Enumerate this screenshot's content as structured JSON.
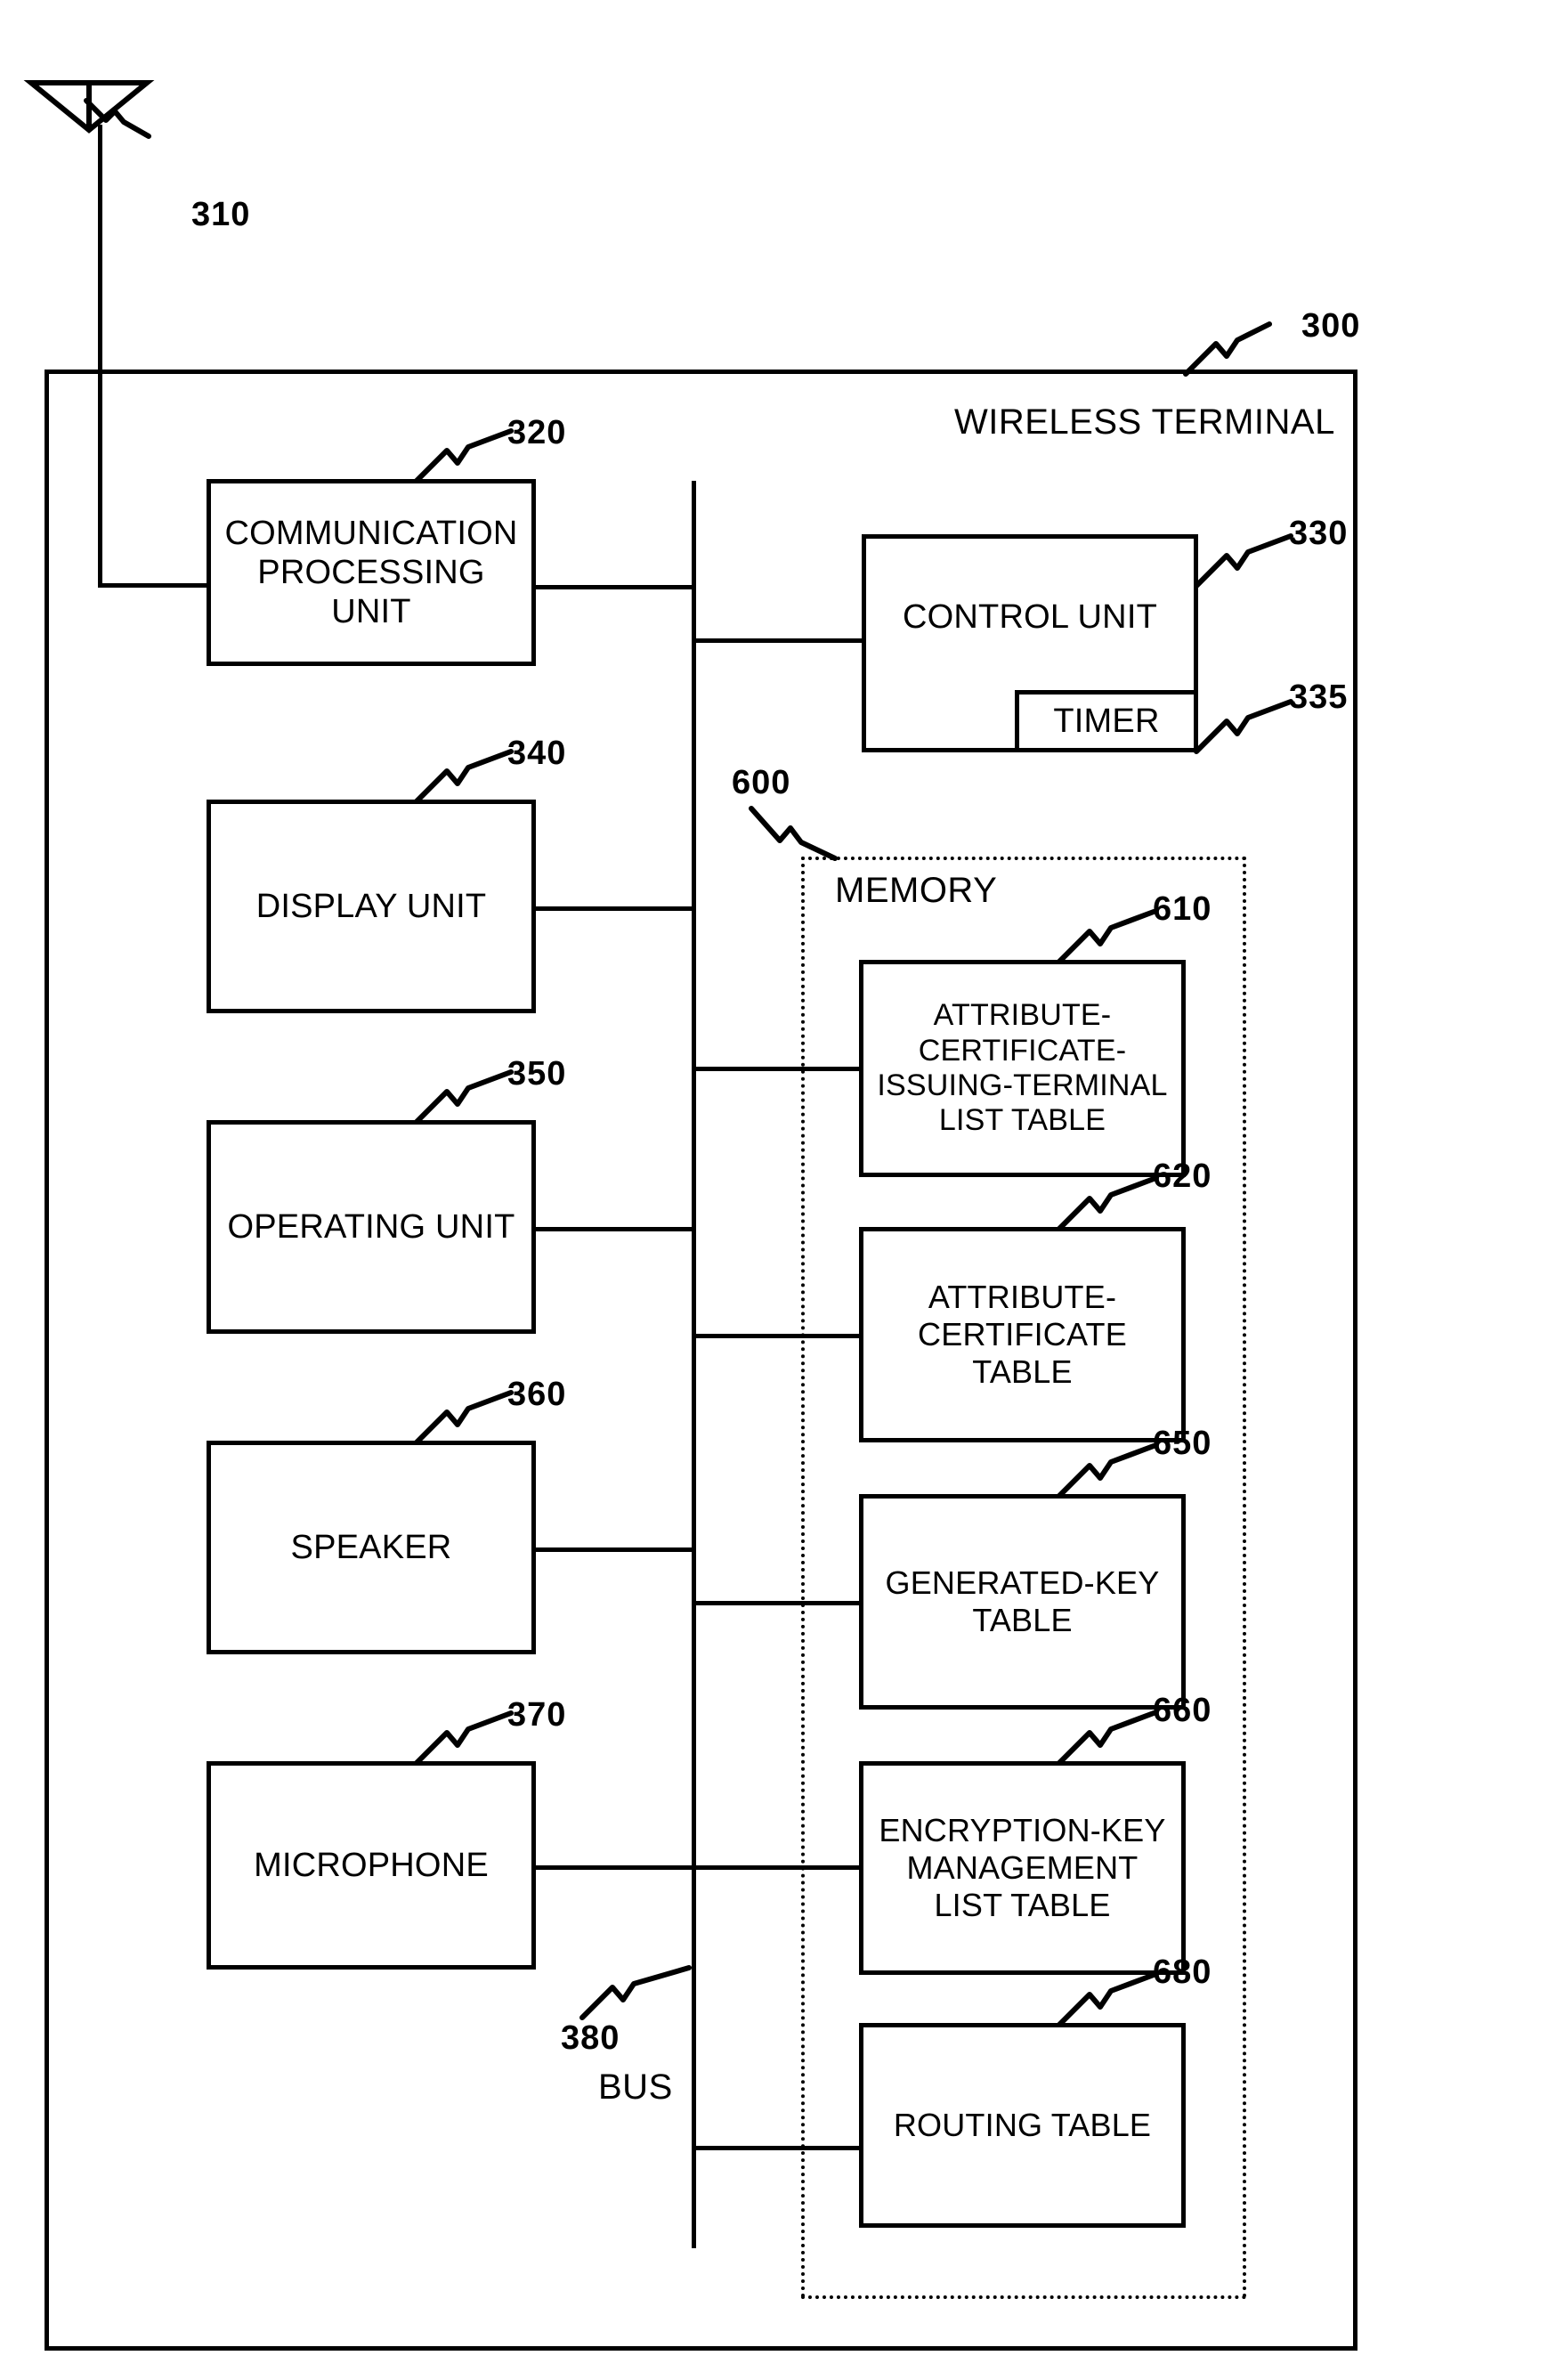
{
  "figure": {
    "outer": {
      "ref": "300",
      "title": "WIRELESS TERMINAL"
    },
    "antenna": {
      "ref": "310",
      "icon": "antenna-icon"
    },
    "bus": {
      "ref": "380",
      "label": "BUS"
    },
    "memory": {
      "ref": "600",
      "title": "MEMORY"
    },
    "left_blocks": [
      {
        "ref": "320",
        "label": "COMMUNICATION PROCESSING UNIT",
        "lines": [
          "COMMUNICATION",
          "PROCESSING",
          "UNIT"
        ]
      },
      {
        "ref": "340",
        "label": "DISPLAY UNIT",
        "lines": [
          "DISPLAY UNIT"
        ]
      },
      {
        "ref": "350",
        "label": "OPERATING UNIT",
        "lines": [
          "OPERATING UNIT"
        ]
      },
      {
        "ref": "360",
        "label": "SPEAKER",
        "lines": [
          "SPEAKER"
        ]
      },
      {
        "ref": "370",
        "label": "MICROPHONE",
        "lines": [
          "MICROPHONE"
        ]
      }
    ],
    "right_blocks": [
      {
        "ref": "330",
        "label": "CONTROL UNIT",
        "lines": [
          "CONTROL UNIT"
        ]
      },
      {
        "ref": "335",
        "label": "TIMER",
        "lines": [
          "TIMER"
        ]
      }
    ],
    "memory_tables": [
      {
        "ref": "610",
        "label": "ATTRIBUTE-CERTIFICATE-ISSUING-TERMINAL LIST TABLE",
        "lines": [
          "ATTRIBUTE-",
          "CERTIFICATE-",
          "ISSUING-TERMINAL",
          "LIST TABLE"
        ]
      },
      {
        "ref": "620",
        "label": "ATTRIBUTE-CERTIFICATE TABLE",
        "lines": [
          "ATTRIBUTE-",
          "CERTIFICATE",
          "TABLE"
        ]
      },
      {
        "ref": "650",
        "label": "GENERATED-KEY TABLE",
        "lines": [
          "GENERATED-KEY",
          "TABLE"
        ]
      },
      {
        "ref": "660",
        "label": "ENCRYPTION-KEY MANAGEMENT LIST TABLE",
        "lines": [
          "ENCRYPTION-KEY",
          "MANAGEMENT",
          "LIST TABLE"
        ]
      },
      {
        "ref": "680",
        "label": "ROUTING TABLE",
        "lines": [
          "ROUTING TABLE"
        ]
      }
    ]
  }
}
